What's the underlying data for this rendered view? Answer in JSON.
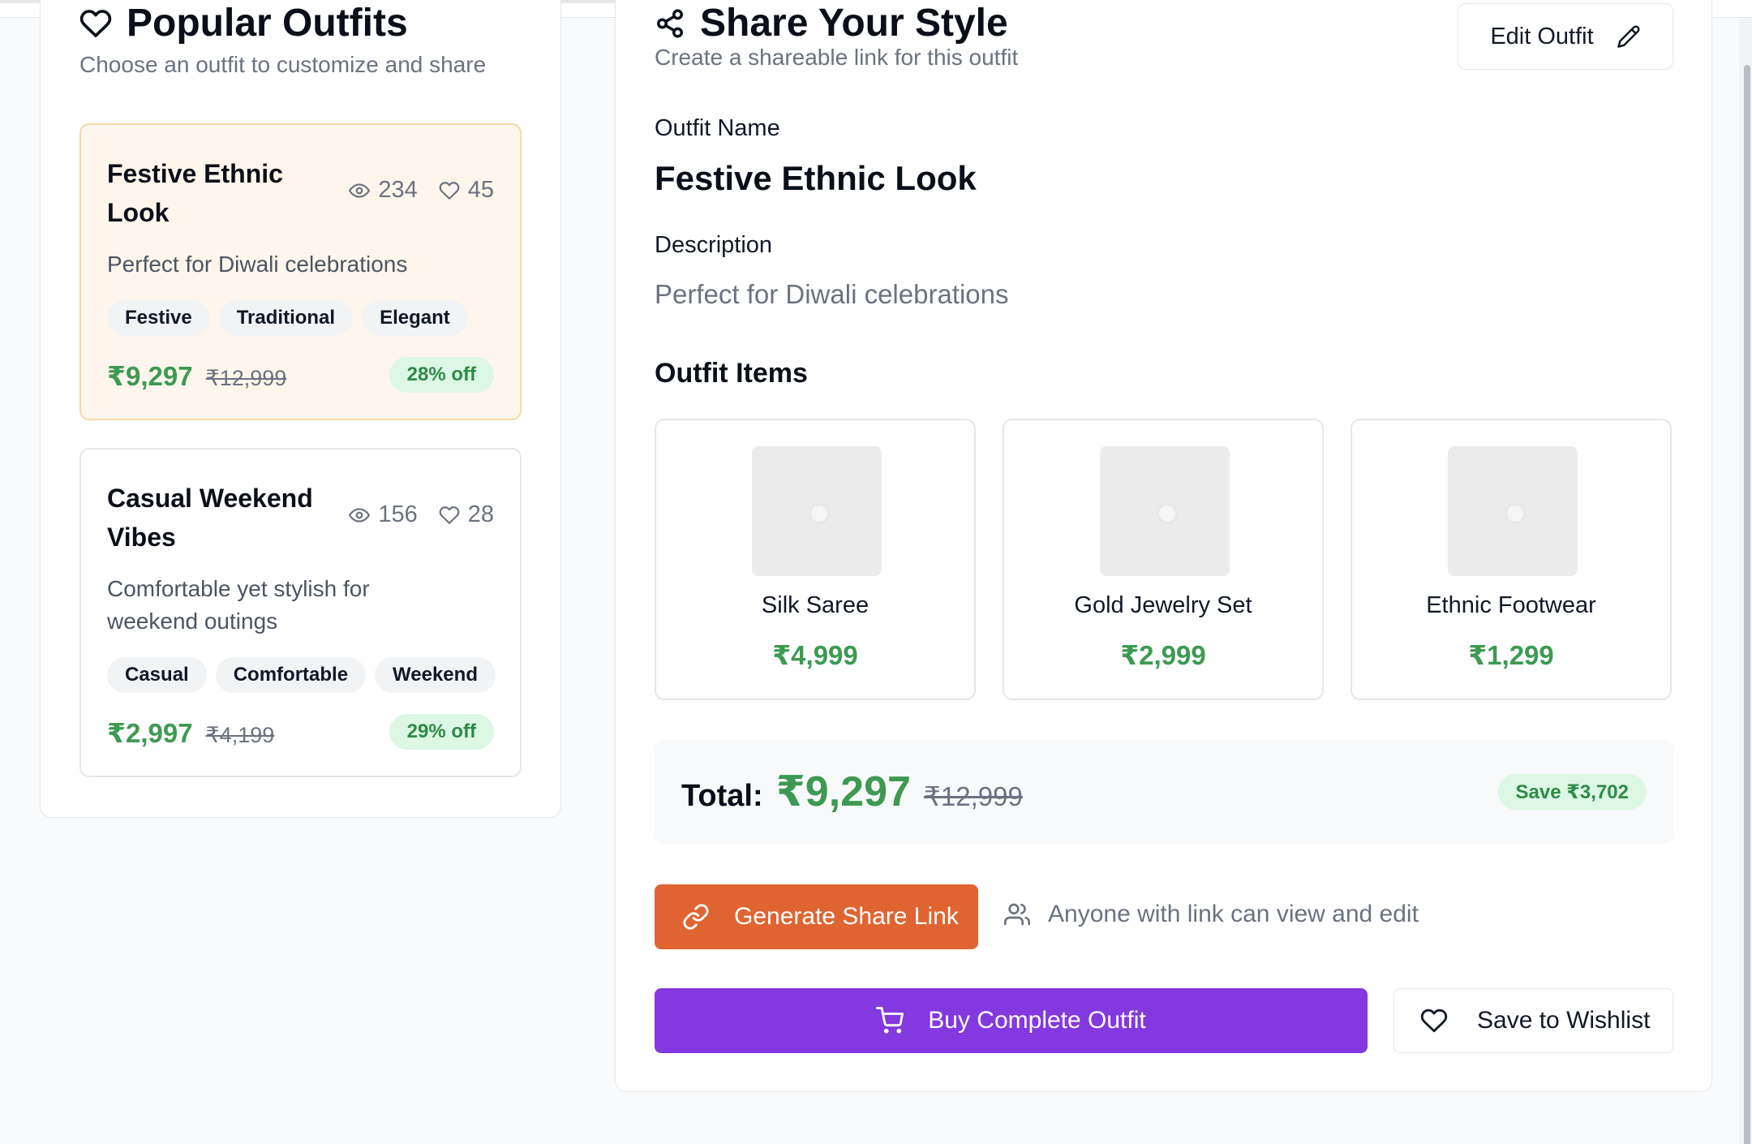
{
  "popular": {
    "title": "Popular Outfits",
    "subtitle": "Choose an outfit to customize and share",
    "outfits": [
      {
        "name": "Festive Ethnic Look",
        "views": "234",
        "likes": "45",
        "description": "Perfect for Diwali celebrations",
        "tags": [
          "Festive",
          "Traditional",
          "Elegant"
        ],
        "price": "₹9,297",
        "original_price": "₹12,999",
        "discount": "28% off",
        "selected": true
      },
      {
        "name": "Casual Weekend Vibes",
        "views": "156",
        "likes": "28",
        "description": "Comfortable yet stylish for weekend outings",
        "tags": [
          "Casual",
          "Comfortable",
          "Weekend"
        ],
        "price": "₹2,997",
        "original_price": "₹4,199",
        "discount": "29% off",
        "selected": false
      }
    ]
  },
  "share": {
    "title": "Share Your Style",
    "subtitle": "Create a shareable link for this outfit",
    "edit_label": "Edit Outfit",
    "outfit_name_label": "Outfit Name",
    "outfit_name": "Festive Ethnic Look",
    "description_label": "Description",
    "description": "Perfect for Diwali celebrations",
    "items_heading": "Outfit Items",
    "items": [
      {
        "name": "Silk Saree",
        "price": "₹4,999"
      },
      {
        "name": "Gold Jewelry Set",
        "price": "₹2,999"
      },
      {
        "name": "Ethnic Footwear",
        "price": "₹1,299"
      }
    ],
    "total_label": "Total:",
    "total": "₹9,297",
    "total_original": "₹12,999",
    "savings": "Save ₹3,702",
    "generate_label": "Generate Share Link",
    "link_note": "Anyone with link can view and edit",
    "buy_label": "Buy Complete Outfit",
    "wishlist_label": "Save to Wishlist"
  },
  "colors": {
    "accent_orange": "#e06431",
    "accent_purple": "#8338e0",
    "price_green": "#3d9a52",
    "selected_card_bg": "#fef6ec"
  }
}
